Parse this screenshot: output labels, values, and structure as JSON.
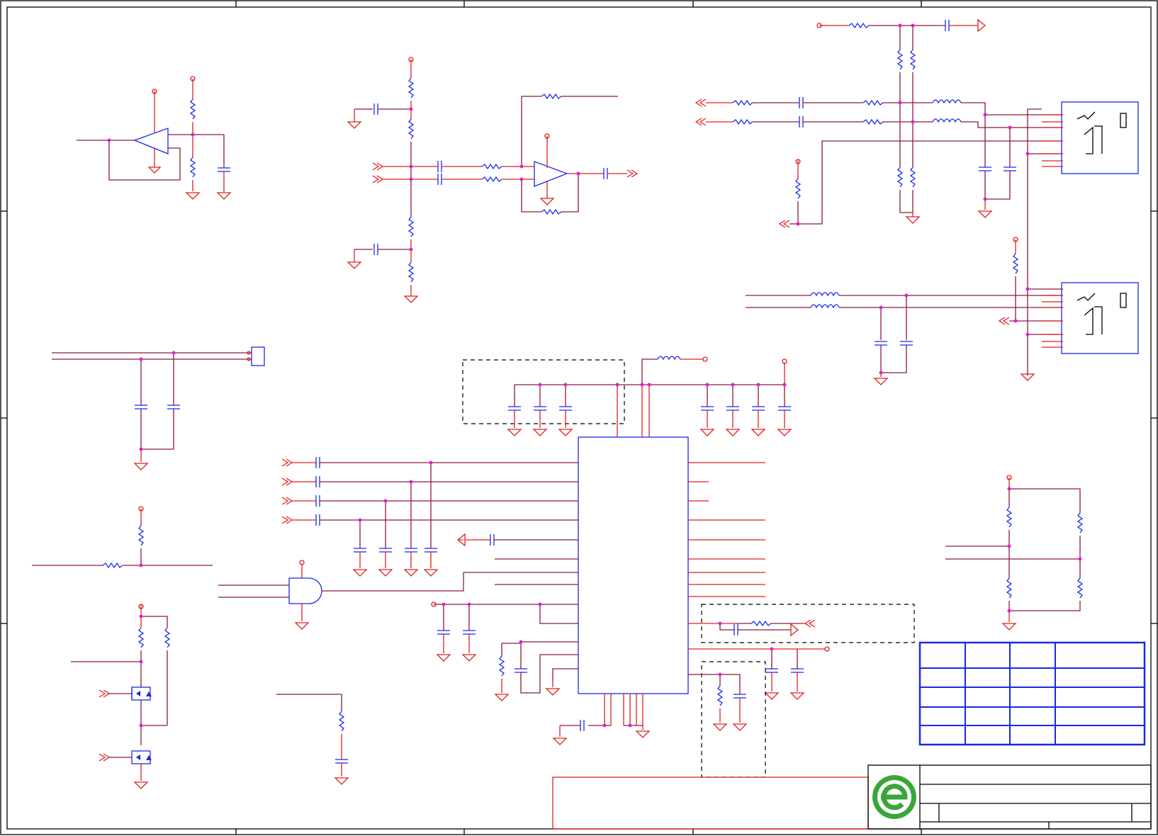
{
  "diagram": {
    "kind": "electronic schematic sheet",
    "colors": {
      "wire": "#8b1a3a",
      "pin": "#e0201e",
      "symbol": "#1a28e8",
      "junction": "#e020d0",
      "frame": "#000000",
      "logo_green": "#3aa63a"
    },
    "title_block": {
      "logo": "company-logo-green-e"
    }
  }
}
